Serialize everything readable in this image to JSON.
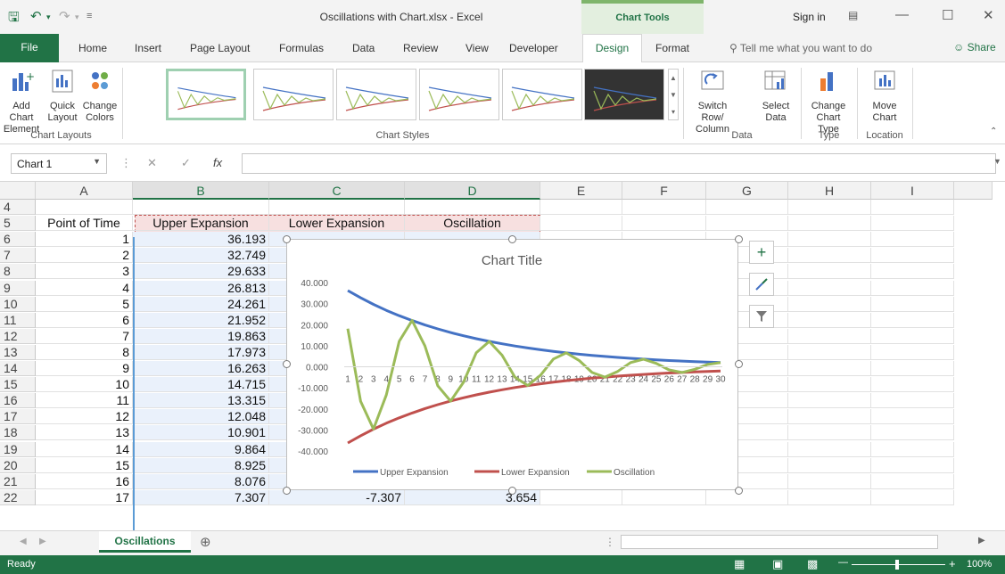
{
  "window": {
    "title": "Oscillations with Chart.xlsx - Excel",
    "contextual_tab_group": "Chart Tools",
    "sign_in": "Sign in"
  },
  "tabs": [
    "File",
    "Home",
    "Insert",
    "Page Layout",
    "Formulas",
    "Data",
    "Review",
    "View",
    "Developer",
    "Design",
    "Format"
  ],
  "tell_me": "Tell me what you want to do",
  "share": "Share",
  "ribbon": {
    "add_chart_element": "Add Chart Element",
    "quick_layout": "Quick Layout",
    "change_colors": "Change Colors",
    "switch_row_column": "Switch Row/ Column",
    "select_data": "Select Data",
    "change_chart_type": "Change Chart Type",
    "move_chart": "Move Chart",
    "groups": {
      "chart_layouts": "Chart Layouts",
      "chart_styles": "Chart Styles",
      "data": "Data",
      "type": "Type",
      "location": "Location"
    }
  },
  "name_box": "Chart 1",
  "formula": "",
  "columns": [
    "A",
    "B",
    "C",
    "D",
    "E",
    "F",
    "G",
    "H",
    "I"
  ],
  "rows": [
    {
      "n": "4",
      "a": "",
      "b": "",
      "c": "",
      "d": ""
    },
    {
      "n": "5",
      "a": "Point of Time",
      "b": "Upper Expansion",
      "c": "Lower Expansion",
      "d": "Oscillation"
    },
    {
      "n": "6",
      "a": "1",
      "b": "36.193",
      "c": "",
      "d": ""
    },
    {
      "n": "7",
      "a": "2",
      "b": "32.749",
      "c": "",
      "d": ""
    },
    {
      "n": "8",
      "a": "3",
      "b": "29.633",
      "c": "",
      "d": ""
    },
    {
      "n": "9",
      "a": "4",
      "b": "26.813",
      "c": "",
      "d": ""
    },
    {
      "n": "10",
      "a": "5",
      "b": "24.261",
      "c": "",
      "d": ""
    },
    {
      "n": "11",
      "a": "6",
      "b": "21.952",
      "c": "",
      "d": ""
    },
    {
      "n": "12",
      "a": "7",
      "b": "19.863",
      "c": "",
      "d": ""
    },
    {
      "n": "13",
      "a": "8",
      "b": "17.973",
      "c": "",
      "d": ""
    },
    {
      "n": "14",
      "a": "9",
      "b": "16.263",
      "c": "",
      "d": ""
    },
    {
      "n": "15",
      "a": "10",
      "b": "14.715",
      "c": "",
      "d": ""
    },
    {
      "n": "16",
      "a": "11",
      "b": "13.315",
      "c": "",
      "d": ""
    },
    {
      "n": "17",
      "a": "12",
      "b": "12.048",
      "c": "",
      "d": ""
    },
    {
      "n": "18",
      "a": "13",
      "b": "10.901",
      "c": "",
      "d": ""
    },
    {
      "n": "19",
      "a": "14",
      "b": "9.864",
      "c": "",
      "d": ""
    },
    {
      "n": "20",
      "a": "15",
      "b": "8.925",
      "c": "",
      "d": ""
    },
    {
      "n": "21",
      "a": "16",
      "b": "8.076",
      "c": "-8.076",
      "d": "-4.038"
    },
    {
      "n": "22",
      "a": "17",
      "b": "7.307",
      "c": "-7.307",
      "d": "3.654"
    }
  ],
  "sheet_tab": "Oscillations",
  "status": {
    "ready": "Ready",
    "zoom": "100%"
  },
  "colors": {
    "excel_green": "#217346",
    "upper": "#4472c4",
    "lower": "#c0504d",
    "osc": "#9bbb59"
  },
  "chart_data": {
    "type": "line",
    "title": "Chart Title",
    "categories": [
      "1",
      "2",
      "3",
      "4",
      "5",
      "6",
      "7",
      "8",
      "9",
      "10",
      "11",
      "12",
      "13",
      "14",
      "15",
      "16",
      "17",
      "18",
      "19",
      "20",
      "21",
      "22",
      "23",
      "24",
      "25",
      "26",
      "27",
      "28",
      "29",
      "30"
    ],
    "ylim": [
      -40,
      40
    ],
    "yticks": [
      "40.000",
      "30.000",
      "20.000",
      "10.000",
      "0.000",
      "-10.000",
      "-20.000",
      "-30.000",
      "-40.000"
    ],
    "legend_position": "bottom",
    "series": [
      {
        "name": "Upper Expansion",
        "color": "#4472c4",
        "values": [
          36.193,
          32.749,
          29.633,
          26.813,
          24.261,
          21.952,
          19.863,
          17.973,
          16.263,
          14.715,
          13.315,
          12.048,
          10.901,
          9.864,
          8.925,
          8.076,
          7.307,
          6.612,
          5.983,
          5.413,
          4.898,
          4.432,
          4.01,
          3.628,
          3.283,
          2.971,
          2.688,
          2.432,
          2.201,
          1.991
        ]
      },
      {
        "name": "Lower Expansion",
        "color": "#c0504d",
        "values": [
          -36.193,
          -32.749,
          -29.633,
          -26.813,
          -24.261,
          -21.952,
          -19.863,
          -17.973,
          -16.263,
          -14.715,
          -13.315,
          -12.048,
          -10.901,
          -9.864,
          -8.925,
          -8.076,
          -7.307,
          -6.612,
          -5.983,
          -5.413,
          -4.898,
          -4.432,
          -4.01,
          -3.628,
          -3.283,
          -2.971,
          -2.688,
          -2.432,
          -2.201,
          -1.991
        ]
      },
      {
        "name": "Oscillation",
        "color": "#9bbb59",
        "values": [
          18.1,
          -16.4,
          -29.6,
          -13.4,
          12.1,
          22.0,
          9.9,
          -9.0,
          -16.3,
          -7.4,
          6.7,
          12.0,
          5.5,
          -4.9,
          -8.9,
          -4.0,
          3.7,
          6.6,
          3.0,
          -2.7,
          -4.9,
          -2.2,
          2.0,
          3.6,
          1.6,
          -1.5,
          -2.7,
          -1.2,
          1.1,
          2.0
        ]
      }
    ]
  }
}
